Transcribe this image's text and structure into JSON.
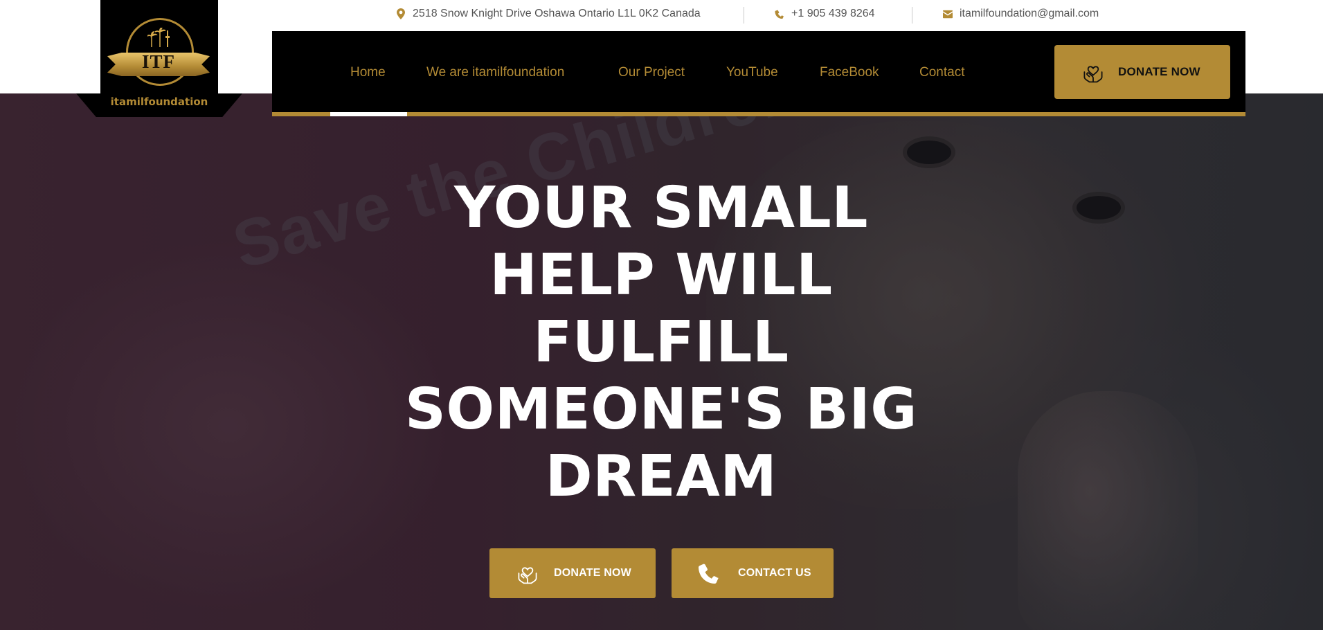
{
  "contact_bar": {
    "address": "2518 Snow Knight Drive Oshawa Ontario L1L 0K2 Canada",
    "phone": "+1 905 439 8264",
    "email": "itamilfoundation@gmail.com"
  },
  "logo": {
    "letters": "ITF",
    "name": "itamilfoundation"
  },
  "nav": {
    "items": [
      {
        "label": "Home",
        "active": true
      },
      {
        "label": "We are itamilfoundation"
      },
      {
        "label": "Our Project"
      },
      {
        "label": "YouTube"
      },
      {
        "label": "FaceBook"
      },
      {
        "label": "Contact"
      }
    ],
    "donate_label": "DONATE NOW"
  },
  "hero": {
    "headline_lines": [
      "YOUR SMALL",
      "HELP WILL",
      "FULFILL",
      "SOMEONE'S BIG",
      "DREAM"
    ],
    "background_text": "Save the Children",
    "donate_button": "DONATE NOW",
    "contact_button": "CONTACT US"
  },
  "colors": {
    "accent": "#b38b35",
    "nav_bg": "#000000",
    "headline": "#ffffff",
    "contact_text": "#555555"
  },
  "icons": {
    "address": "map-pin-icon",
    "phone": "phone-icon",
    "email": "envelope-icon",
    "donate": "heart-hands-icon",
    "contact": "phone-handset-icon"
  }
}
